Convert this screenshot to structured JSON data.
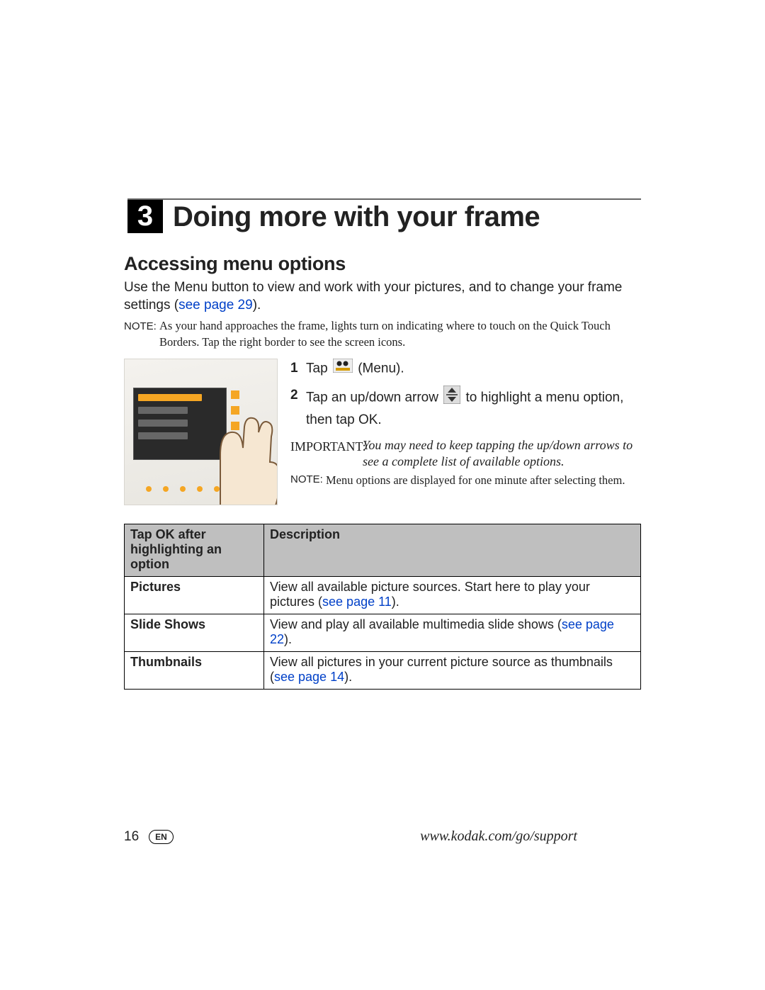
{
  "chapter": {
    "number": "3",
    "title": "Doing more with your frame"
  },
  "section": {
    "title": "Accessing menu options"
  },
  "intro": {
    "text_a": "Use the Menu button to view and work with your pictures, and to change your frame settings (",
    "link": "see page 29",
    "text_b": ")."
  },
  "note1": {
    "label": "NOTE:",
    "text": "As your hand approaches the frame, lights turn on indicating where to touch on the Quick Touch Borders. Tap the right border to see the screen icons."
  },
  "steps": {
    "s1": {
      "num": "1",
      "a": "Tap ",
      "b": " (Menu)."
    },
    "s2": {
      "num": "2",
      "a": "Tap an up/down arrow ",
      "b": " to highlight a menu option, then tap OK."
    }
  },
  "important": {
    "label": "IMPORTANT:",
    "text": "You may need to keep tapping the up/down arrows to see a complete list of available options."
  },
  "note2": {
    "label": "NOTE:",
    "text": "Menu options are displayed for one minute after selecting them."
  },
  "table": {
    "h1": "Tap OK after highlighting an option",
    "h2": "Description",
    "rows": [
      {
        "name": "Pictures",
        "desc_a": "View all available picture sources. Start here to play your pictures (",
        "link": "see page 11",
        "desc_b": ")."
      },
      {
        "name": "Slide Shows",
        "desc_a": "View and play all available multimedia slide shows (",
        "link": "see page 22",
        "desc_b": ")."
      },
      {
        "name": "Thumbnails",
        "desc_a": "View all pictures in your current picture source as thumbnails (",
        "link": "see page 14",
        "desc_b": ")."
      }
    ]
  },
  "footer": {
    "page": "16",
    "lang": "EN",
    "url": "www.kodak.com/go/support"
  }
}
